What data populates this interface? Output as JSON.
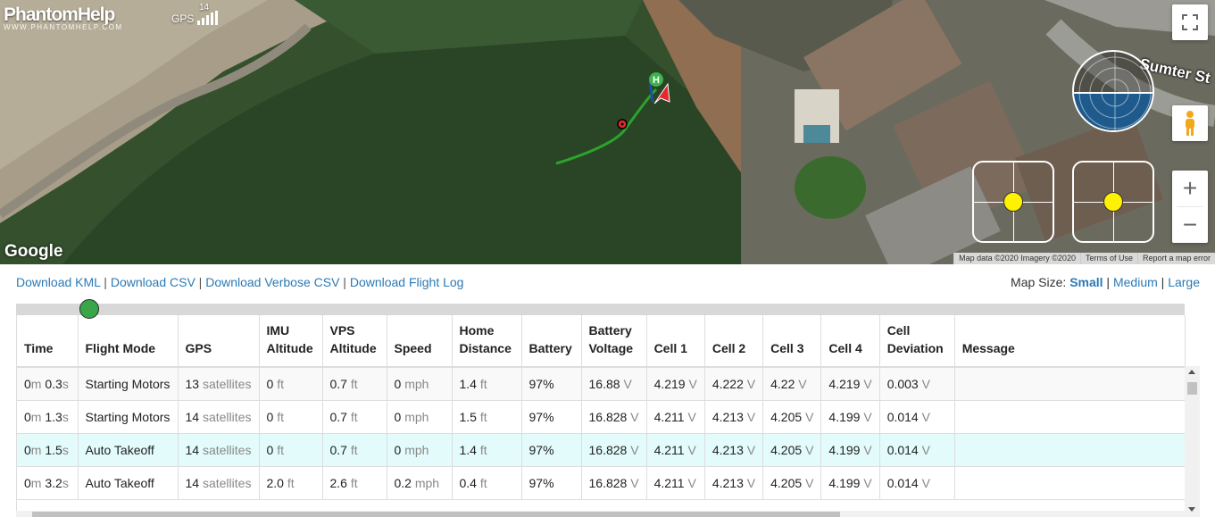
{
  "map": {
    "brand": "PhantomHelp",
    "brand_sub": "WWW.PHANTOMHELP.COM",
    "gps_label": "GPS",
    "gps_satellites": "14",
    "provider": "Google",
    "street_label": "Sumter St",
    "home_marker": "H",
    "attribution": {
      "map_data": "Map data ©2020 Imagery ©2020",
      "terms": "Terms of Use",
      "report": "Report a map error"
    },
    "zoom_in": "+",
    "zoom_out": "−",
    "colors": {
      "flight_path": "#2aa42a",
      "home": "#3cb44b",
      "drone_arrow": "#e5282c",
      "gimbal_dot": "#fef200",
      "attitude_sky": "#1e5a8c"
    }
  },
  "links": {
    "download_kml": "Download KML",
    "download_csv": "Download CSV",
    "download_verbose_csv": "Download Verbose CSV",
    "download_flight_log": "Download Flight Log",
    "separator": " | "
  },
  "map_size": {
    "label": "Map Size:",
    "small": "Small",
    "medium": "Medium",
    "large": "Large"
  },
  "timeline": {
    "position_fraction": 0.054
  },
  "table": {
    "headers": [
      "Time",
      "Flight Mode",
      "GPS",
      "IMU Altitude",
      "VPS Altitude",
      "Speed",
      "Home Distance",
      "Battery",
      "Battery Voltage",
      "Cell 1",
      "Cell 2",
      "Cell 3",
      "Cell 4",
      "Cell Deviation",
      "Message"
    ],
    "rows": [
      {
        "time_m": "0",
        "time_s": "0.3",
        "mode": "Starting Motors",
        "gps": "13",
        "imu": "0",
        "vps": "0.7",
        "speed": "0",
        "home": "1.4",
        "battery": "97%",
        "voltage": "16.88",
        "c1": "4.219",
        "c2": "4.222",
        "c3": "4.22",
        "c4": "4.219",
        "dev": "0.003",
        "msg": ""
      },
      {
        "time_m": "0",
        "time_s": "1.3",
        "mode": "Starting Motors",
        "gps": "14",
        "imu": "0",
        "vps": "0.7",
        "speed": "0",
        "home": "1.5",
        "battery": "97%",
        "voltage": "16.828",
        "c1": "4.211",
        "c2": "4.213",
        "c3": "4.205",
        "c4": "4.199",
        "dev": "0.014",
        "msg": ""
      },
      {
        "time_m": "0",
        "time_s": "1.5",
        "mode": "Auto Takeoff",
        "gps": "14",
        "imu": "0",
        "vps": "0.7",
        "speed": "0",
        "home": "1.4",
        "battery": "97%",
        "voltage": "16.828",
        "c1": "4.211",
        "c2": "4.213",
        "c3": "4.205",
        "c4": "4.199",
        "dev": "0.014",
        "msg": "",
        "selected": true
      },
      {
        "time_m": "0",
        "time_s": "3.2",
        "mode": "Auto Takeoff",
        "gps": "14",
        "imu": "2.0",
        "vps": "2.6",
        "speed": "0.2",
        "home": "0.4",
        "battery": "97%",
        "voltage": "16.828",
        "c1": "4.211",
        "c2": "4.213",
        "c3": "4.205",
        "c4": "4.199",
        "dev": "0.014",
        "msg": ""
      }
    ],
    "units": {
      "min": "m",
      "sec": "s",
      "sats": "satellites",
      "ft": "ft",
      "mph": "mph",
      "volt": "V"
    }
  }
}
